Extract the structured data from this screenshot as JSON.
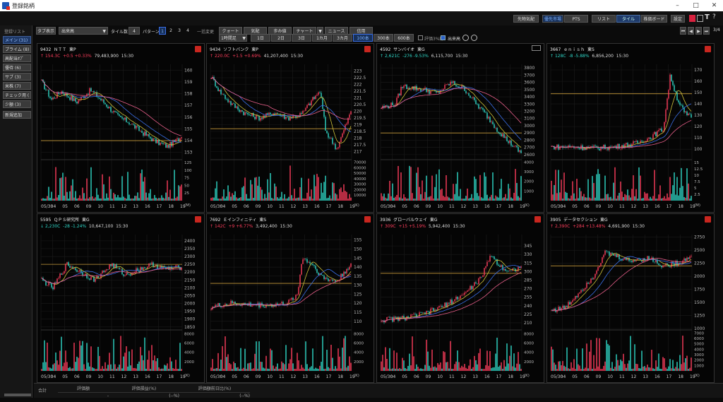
{
  "app": {
    "title": "登録銘柄",
    "min_icon": "minimize-icon",
    "max_icon": "maximize-icon",
    "close_icon": "close-icon"
  },
  "topbar": {
    "btn1": "先物気配",
    "btn2": "優先市場",
    "btn3": "PTS",
    "btn4": "リスト",
    "btn5": "タイル",
    "btn6": "株価ボード",
    "btn7": "設定"
  },
  "sidebar": {
    "label": "登録リスト",
    "items": [
      "メイン (31)",
      "プライム (8)",
      "高配当ｵﾌﾟ",
      "優待 (6)",
      "サブ (3)",
      "米株 (7)",
      "チェック用 (",
      "少額 (3)",
      "新規追加"
    ]
  },
  "ctrl": {
    "tab_label": "タブ表示",
    "select_value": "出来高",
    "tiles_label": "タイル数",
    "tiles_value": "4",
    "pattern_label": "パターン",
    "patterns": [
      "1",
      "2",
      "3",
      "4"
    ],
    "change_label": "一括変更",
    "tools": [
      "クォート",
      "気配",
      "歩み値",
      "チャート",
      "ニュース",
      "信用"
    ],
    "interval": "1時間足",
    "spans": [
      "1日",
      "2日",
      "3日",
      "1カ月",
      "3カ月",
      "100本",
      "300本",
      "600本"
    ],
    "check1": "評価3%線",
    "check2": "出来高",
    "page": "3/4"
  },
  "colors": {
    "up": "#ff3e5c",
    "down": "#2fd9c9",
    "ma1": "#3a6fe8",
    "ma2": "#cfc23a",
    "ma3": "#e85f8a",
    "hline": "#c79a3a"
  },
  "date_labels": [
    "05/30",
    "04",
    "05",
    "06",
    "09",
    "10",
    "11",
    "12",
    "13",
    "16",
    "17",
    "18",
    "19"
  ],
  "vol_unit": "(K)",
  "footer": {
    "total": "合計",
    "c1": "評価額",
    "c2": "評価損益(%)",
    "c3": "評価額前日比(%)",
    "v1": "-",
    "v2": "(--%)",
    "v3": "(--%)"
  },
  "panels": [
    {
      "code": "9432",
      "name": "ＮＴＴ",
      "market": "東P",
      "dir": "↑",
      "price": "154.3C",
      "change": "+0.5 +0.33%",
      "volume": "79,483,900",
      "time": "15:30",
      "up": true,
      "flag": true,
      "chart_data": {
        "type": "candlestick",
        "ylim": [
          152.5,
          160.5
        ],
        "yticks": [
          153,
          154,
          155,
          156,
          157,
          158,
          159,
          160
        ],
        "vticks": [
          25,
          50,
          75,
          100,
          125
        ],
        "vmax": 130,
        "vunit": "(M)",
        "start": 159.3,
        "end": 154.3,
        "hline": 154,
        "path": [
          [
            0,
            159
          ],
          [
            0.07,
            157.5
          ],
          [
            0.14,
            158.2
          ],
          [
            0.25,
            157.3
          ],
          [
            0.35,
            158.3
          ],
          [
            0.45,
            157.2
          ],
          [
            0.55,
            156
          ],
          [
            0.62,
            155.6
          ],
          [
            0.72,
            154.7
          ],
          [
            0.82,
            153.9
          ],
          [
            0.9,
            153.5
          ],
          [
            1,
            154.3
          ]
        ]
      }
    },
    {
      "code": "9434",
      "name": "ソフトバンク",
      "market": "東P",
      "dir": "↑",
      "price": "220.0C",
      "change": "+1.5 +0.69%",
      "volume": "41,207,400",
      "time": "15:30",
      "up": true,
      "flag": true,
      "chart_data": {
        "type": "candlestick",
        "ylim": [
          216.5,
          223.5
        ],
        "yticks": [
          217,
          217.5,
          218,
          218.5,
          219,
          219.5,
          220,
          220.5,
          221,
          221.5,
          222,
          222.5,
          223
        ],
        "vticks": [
          10000,
          20000,
          30000,
          40000,
          50000,
          60000,
          70000
        ],
        "vmax": 72000,
        "vunit": "(K)",
        "start": 222.5,
        "end": 220,
        "hline": 218.7,
        "path": [
          [
            0,
            222.6
          ],
          [
            0.06,
            221.5
          ],
          [
            0.15,
            220.5
          ],
          [
            0.25,
            219.8
          ],
          [
            0.35,
            219.5
          ],
          [
            0.45,
            219.9
          ],
          [
            0.55,
            219.5
          ],
          [
            0.65,
            219.8
          ],
          [
            0.72,
            220.8
          ],
          [
            0.78,
            221.5
          ],
          [
            0.82,
            218.5
          ],
          [
            0.9,
            217.2
          ],
          [
            1,
            220
          ]
        ]
      }
    },
    {
      "code": "4592",
      "name": "サンバイオ",
      "market": "東G",
      "dir": "↑",
      "price": "2,621C",
      "change": "-276 -9.53%",
      "volume": "6,115,700",
      "time": "15:30",
      "up": false,
      "flag": false,
      "chart_data": {
        "type": "candlestick",
        "ylim": [
          2550,
          3850
        ],
        "yticks": [
          2600,
          2700,
          2800,
          2900,
          3000,
          3100,
          3200,
          3300,
          3400,
          3500,
          3600,
          3700,
          3800
        ],
        "vticks": [
          1000,
          2000,
          3000,
          4000
        ],
        "vmax": 4100,
        "vunit": "(K)",
        "start": 3250,
        "end": 2621,
        "hline": 2900,
        "path": [
          [
            0,
            3250
          ],
          [
            0.1,
            3300
          ],
          [
            0.15,
            3550
          ],
          [
            0.3,
            3500
          ],
          [
            0.4,
            3450
          ],
          [
            0.5,
            3600
          ],
          [
            0.6,
            3500
          ],
          [
            0.68,
            3300
          ],
          [
            0.75,
            3150
          ],
          [
            0.83,
            2950
          ],
          [
            0.9,
            2800
          ],
          [
            1,
            2621
          ]
        ]
      }
    },
    {
      "code": "3667",
      "name": "ｅｎｉｓｈ",
      "market": "東S",
      "dir": "↑",
      "price": "128C",
      "change": "-8 -5.88%",
      "volume": "6,856,200",
      "time": "15:30",
      "up": false,
      "flag": true,
      "chart_data": {
        "type": "candlestick",
        "ylim": [
          92,
          175
        ],
        "yticks": [
          100,
          110,
          120,
          130,
          140,
          150,
          160,
          170
        ],
        "vticks": [
          2.5,
          5,
          7.5,
          10,
          12.5,
          15
        ],
        "vmax": 15.5,
        "vunit": "(M)",
        "start": 102,
        "end": 128,
        "hline": 149,
        "path": [
          [
            0,
            102
          ],
          [
            0.15,
            102
          ],
          [
            0.3,
            101
          ],
          [
            0.45,
            102
          ],
          [
            0.6,
            105
          ],
          [
            0.7,
            110
          ],
          [
            0.8,
            118
          ],
          [
            0.85,
            165
          ],
          [
            0.9,
            145
          ],
          [
            0.95,
            132
          ],
          [
            1,
            128
          ]
        ]
      }
    },
    {
      "code": "5595",
      "name": "ＱＰＳ研究所",
      "market": "東G",
      "dir": "↓",
      "price": "2,230C",
      "change": "-28 -1.24%",
      "volume": "10,647,100",
      "time": "15:30",
      "up": false,
      "flag": true,
      "chart_data": {
        "type": "candlestick",
        "ylim": [
          1840,
          2440
        ],
        "yticks": [
          1850,
          1900,
          1950,
          2000,
          2050,
          2100,
          2150,
          2200,
          2250,
          2300,
          2350,
          2400
        ],
        "vticks": [
          2000,
          4000,
          6000,
          8000
        ],
        "vmax": 8500,
        "vunit": "(K)",
        "start": 2150,
        "end": 2230,
        "hline": 2250,
        "path": [
          [
            0,
            2150
          ],
          [
            0.08,
            2100
          ],
          [
            0.18,
            2250
          ],
          [
            0.28,
            2200
          ],
          [
            0.38,
            2150
          ],
          [
            0.5,
            2250
          ],
          [
            0.6,
            2180
          ],
          [
            0.7,
            2220
          ],
          [
            0.8,
            2250
          ],
          [
            0.88,
            2220
          ],
          [
            1,
            2230
          ]
        ]
      }
    },
    {
      "code": "7692",
      "name": "Ｅインフィニティ",
      "market": "東S",
      "dir": "↑",
      "price": "142C",
      "change": "+9 +6.77%",
      "volume": "3,492,400",
      "time": "15:30",
      "up": true,
      "flag": true,
      "chart_data": {
        "type": "candlestick",
        "ylim": [
          106,
          158
        ],
        "yticks": [
          110,
          115,
          120,
          125,
          130,
          135,
          140,
          145,
          150,
          155
        ],
        "vticks": [
          2000,
          4000,
          6000,
          8000
        ],
        "vmax": 8500,
        "vunit": "(K)",
        "start": 118,
        "end": 142,
        "hline": 131,
        "path": [
          [
            0,
            118
          ],
          [
            0.15,
            120
          ],
          [
            0.3,
            119
          ],
          [
            0.45,
            119
          ],
          [
            0.55,
            120
          ],
          [
            0.62,
            125
          ],
          [
            0.65,
            145
          ],
          [
            0.72,
            142
          ],
          [
            0.8,
            134
          ],
          [
            0.9,
            132
          ],
          [
            1,
            142
          ]
        ]
      }
    },
    {
      "code": "3936",
      "name": "グローバルウェイ",
      "market": "東G",
      "dir": "↑",
      "price": "309C",
      "change": "+15 +5.19%",
      "volume": "5,942,400",
      "time": "15:30",
      "up": true,
      "flag": true,
      "chart_data": {
        "type": "candlestick",
        "ylim": [
          200,
          365
        ],
        "yticks": [
          210,
          225,
          240,
          255,
          270,
          285,
          300,
          315,
          330,
          345
        ],
        "vticks": [
          2000,
          4000,
          6000,
          8000
        ],
        "vmax": 8500,
        "vunit": "(K)",
        "start": 215,
        "end": 309,
        "hline": 297,
        "path": [
          [
            0,
            215
          ],
          [
            0.15,
            218
          ],
          [
            0.3,
            225
          ],
          [
            0.45,
            240
          ],
          [
            0.6,
            262
          ],
          [
            0.72,
            290
          ],
          [
            0.78,
            330
          ],
          [
            0.85,
            310
          ],
          [
            0.92,
            300
          ],
          [
            1,
            309
          ]
        ]
      }
    },
    {
      "code": "3905",
      "name": "データセクション",
      "market": "東G",
      "dir": "↑",
      "price": "2,390C",
      "change": "+284 +13.48%",
      "volume": "4,691,900",
      "time": "15:30",
      "up": true,
      "flag": true,
      "chart_data": {
        "type": "candlestick",
        "ylim": [
          1000,
          2800
        ],
        "yticks": [
          1000,
          1250,
          1500,
          1750,
          2000,
          2250,
          2500,
          2750
        ],
        "vticks": [
          1000,
          2000,
          3000,
          4000,
          5000,
          6000,
          7000
        ],
        "vmax": 7300,
        "vunit": "(K)",
        "start": 1350,
        "end": 2390,
        "hline": 2200,
        "path": [
          [
            0,
            1350
          ],
          [
            0.1,
            1400
          ],
          [
            0.2,
            1700
          ],
          [
            0.3,
            2000
          ],
          [
            0.38,
            2450
          ],
          [
            0.45,
            2400
          ],
          [
            0.55,
            2300
          ],
          [
            0.7,
            2350
          ],
          [
            0.8,
            2200
          ],
          [
            0.9,
            2250
          ],
          [
            1,
            2390
          ]
        ]
      }
    }
  ]
}
